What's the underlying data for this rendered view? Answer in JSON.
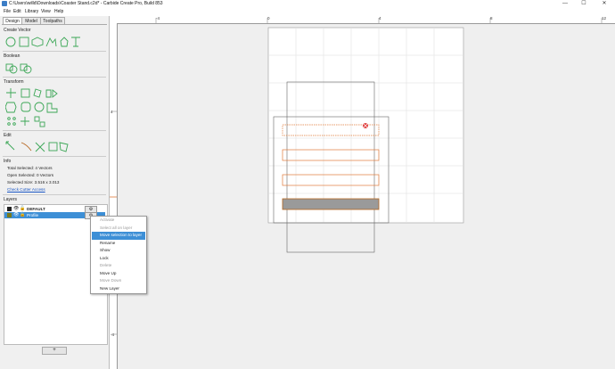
{
  "window": {
    "title": "C:\\Users\\willd\\Downloads\\Coaster Stand.c2d* - Carbide Create Pro, Build 853",
    "minimize": "—",
    "maximize": "☐",
    "close": "✕"
  },
  "menu": [
    "File",
    "Edit",
    "Library",
    "View",
    "Help"
  ],
  "tabs": [
    "Design",
    "Model",
    "Toolpaths"
  ],
  "sections": {
    "create_vector": "Create Vector",
    "boolean": "Boolean",
    "transform": "Transform",
    "edit": "Edit",
    "info": "Info",
    "layers": "Layers"
  },
  "info": {
    "total_selected": "Total Selected:  4 Vectors",
    "open_selected": "Open Selected:  0 Vectors",
    "selected_size": "Selected Size:    3.516 x 3.013",
    "cutter_access": "Check Cutter Access"
  },
  "layers": [
    {
      "name": "DEFAULT",
      "color": "#222222"
    },
    {
      "name": "Profile",
      "color": "#7a7a1a"
    }
  ],
  "layers_add": "+",
  "ruler": {
    "top_labels": [
      "-4",
      "0",
      "4",
      "8",
      "12"
    ],
    "left_labels": [
      "4",
      "0",
      "-4"
    ]
  },
  "context_menu": [
    {
      "label": "Activate",
      "disabled": true
    },
    {
      "label": "Select all on layer",
      "disabled": true
    },
    {
      "label": "Move selection to layer",
      "highlight": true
    },
    {
      "label": "Rename"
    },
    {
      "label": "Show"
    },
    {
      "label": "Lock"
    },
    {
      "label": "Delete",
      "disabled": true
    },
    {
      "label": "Move Up"
    },
    {
      "label": "Move Down",
      "disabled": true
    },
    {
      "label": "New Layer"
    }
  ],
  "colors": {
    "accent": "#3d8fd6",
    "vector_orange": "#e07b39",
    "icon_green": "#3aa655",
    "selected_layer": "#3d8fd6"
  }
}
